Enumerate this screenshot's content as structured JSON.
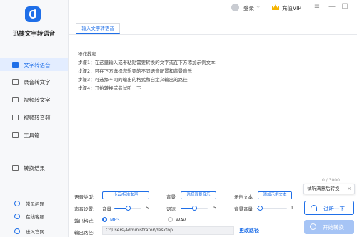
{
  "app": {
    "brand": "迅捷文字转语音"
  },
  "titlebar": {
    "login": "登录",
    "vip": "充值VIP"
  },
  "sidebar": {
    "items": [
      {
        "label": "文字转语音"
      },
      {
        "label": "录音转文字"
      },
      {
        "label": "视频转文字"
      },
      {
        "label": "视频转音频"
      },
      {
        "label": "工具箱"
      },
      {
        "label": "转换结果"
      }
    ],
    "footer": [
      {
        "label": "常见问题"
      },
      {
        "label": "在线客服"
      },
      {
        "label": "进入官网"
      }
    ]
  },
  "tab": {
    "label": "输入文字转语音"
  },
  "editor": {
    "lines": [
      "操作教程",
      "步骤1：在这里输入或者粘贴需要转换的文字或在下方添加示例文本",
      "步骤2：可在下方选择您想要的不同语音配置和背景音乐",
      "步骤3：可选择不同的输出的格式和自定义输出的路径",
      "步骤4：开始转换或者试听一下"
    ],
    "counter": "0 / 3000"
  },
  "settings": {
    "voice_type_label": "语音类型:",
    "voice_type_value": "小云/标准女声",
    "bgm_label": "背景",
    "bgm_button": "选择背景音乐",
    "sample_label": "示例文本",
    "sample_button": "添加示例文本",
    "sound_label": "声音设置:",
    "volume_label": "音量",
    "volume_value": "5",
    "volume_level": 0.5,
    "speed_label": "语速",
    "speed_value": "5",
    "speed_level": 0.5,
    "bg_volume_label": "背景音量",
    "bg_volume_value": "1",
    "bg_volume_level": 0.1,
    "format_label": "输出格式:",
    "format_options": [
      "MP3",
      "WAV"
    ],
    "format_selected": "MP3",
    "path_label": "输出路径:",
    "path_value": "C:\\Users\\Administrator\\desktop",
    "change_path": "更改路径"
  },
  "actions": {
    "tooltip": "试听满意后转换",
    "listen": "试听一下",
    "convert": "开始转换"
  },
  "colors": {
    "accent": "#1f6fe8",
    "vip": "#f5b400",
    "sidebar_bg": "#f7f8fa",
    "active_bg": "#e3edff"
  }
}
